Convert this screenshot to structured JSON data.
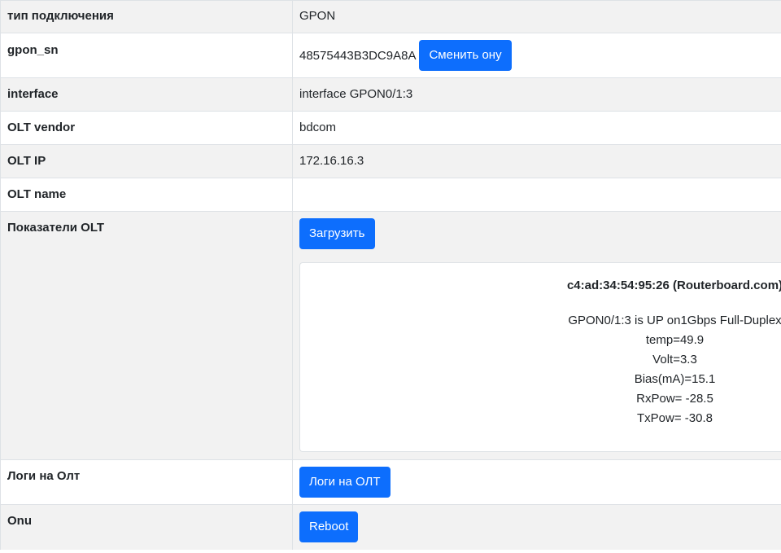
{
  "rows": {
    "connection_type": {
      "label": "тип подключения",
      "value": "GPON"
    },
    "gpon_sn": {
      "label": "gpon_sn",
      "value": "48575443B3DC9A8A",
      "button": "Сменить ону"
    },
    "interface": {
      "label": "interface",
      "value": "interface GPON0/1:3"
    },
    "olt_vendor": {
      "label": "OLT vendor",
      "value": "bdcom"
    },
    "olt_ip": {
      "label": "OLT IP",
      "value": "172.16.16.3"
    },
    "olt_name": {
      "label": "OLT name",
      "value": ""
    },
    "olt_metrics": {
      "label": "Показатели OLT",
      "button": "Загрузить",
      "panel": {
        "title": "c4:ad:34:54:95:26 (Routerboard.com)",
        "lines": [
          "GPON0/1:3 is UP on1Gbps Full-Duplex",
          "temp=49.9",
          "Volt=3.3",
          "Bias(mA)=15.1",
          "RxPow= -28.5",
          "TxPow= -30.8"
        ]
      }
    },
    "olt_logs": {
      "label": "Логи на Олт",
      "button": "Логи на ОЛТ"
    },
    "onu": {
      "label": "Onu",
      "button": "Reboot"
    }
  },
  "colors": {
    "primary_button": "#0d6efd",
    "striped_row": "#f2f2f2",
    "border": "#dee2e6"
  }
}
